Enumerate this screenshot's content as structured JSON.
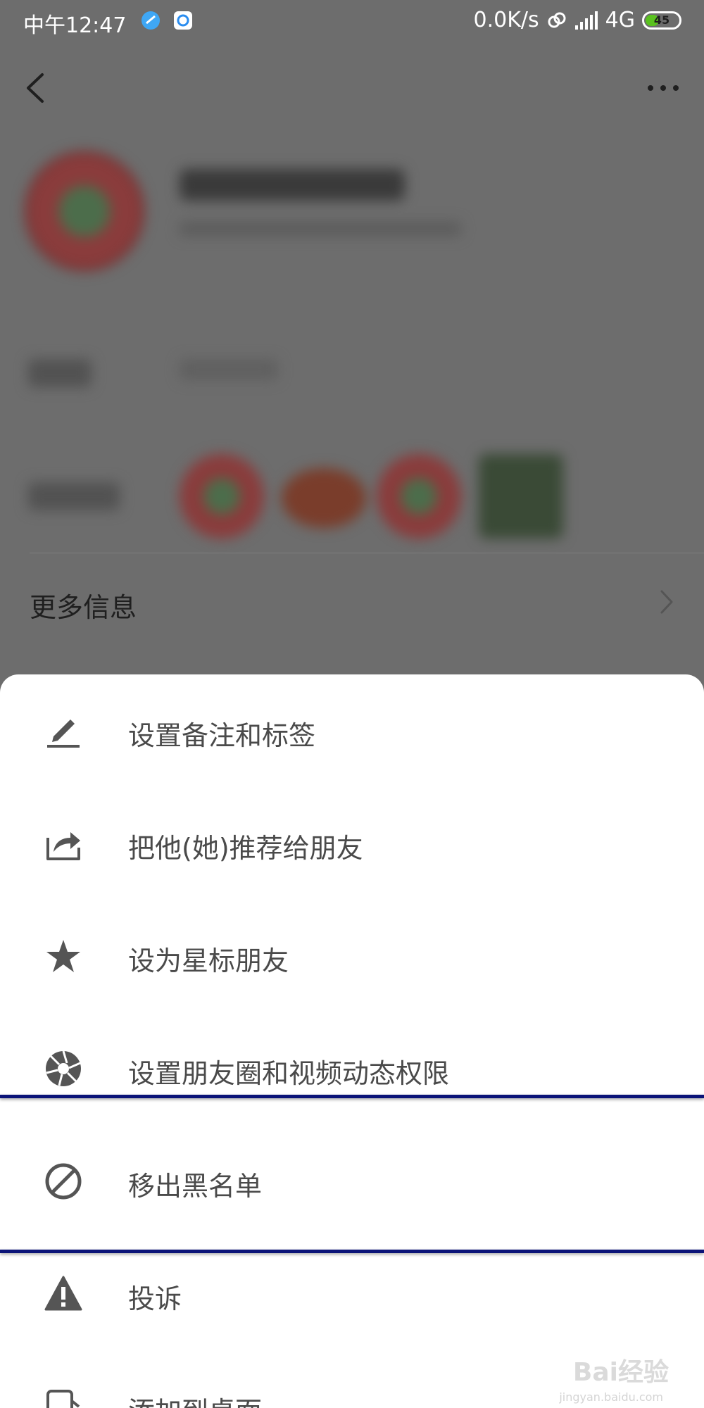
{
  "status_bar": {
    "time": "中午12:47",
    "network_speed": "0.0K/s",
    "network_type": "4G",
    "battery": "45",
    "battery_color": "#5ac21f"
  },
  "top_bar": {
    "back_icon": "chevron-left-icon",
    "more_icon": "more-horizontal-icon"
  },
  "profile": {
    "more_info_label": "更多信息"
  },
  "menu": {
    "items": [
      {
        "label": "设置备注和标签",
        "icon": "edit-icon"
      },
      {
        "label": "把他(她)推荐给朋友",
        "icon": "share-icon"
      },
      {
        "label": "设为星标朋友",
        "icon": "star-icon"
      },
      {
        "label": "设置朋友圈和视频动态权限",
        "icon": "aperture-icon"
      },
      {
        "label": "移出黑名单",
        "icon": "block-icon"
      },
      {
        "label": "投诉",
        "icon": "warning-icon"
      },
      {
        "label": "添加到桌面",
        "icon": "add-to-desktop-icon"
      }
    ],
    "highlight_color": "#0b1478"
  },
  "watermark": {
    "text": "Bai经验",
    "sub": "jingyan.baidu.com"
  }
}
